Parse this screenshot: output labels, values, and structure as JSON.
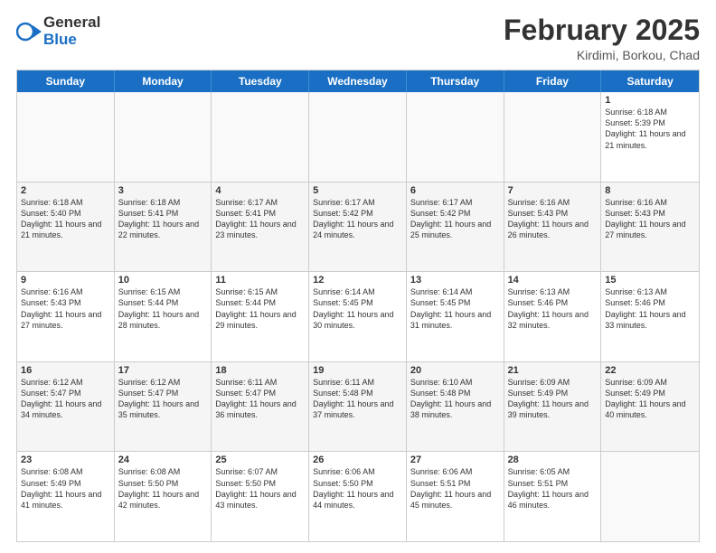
{
  "logo": {
    "general": "General",
    "blue": "Blue"
  },
  "title": "February 2025",
  "location": "Kirdimi, Borkou, Chad",
  "header_days": [
    "Sunday",
    "Monday",
    "Tuesday",
    "Wednesday",
    "Thursday",
    "Friday",
    "Saturday"
  ],
  "weeks": [
    [
      {
        "day": "",
        "text": ""
      },
      {
        "day": "",
        "text": ""
      },
      {
        "day": "",
        "text": ""
      },
      {
        "day": "",
        "text": ""
      },
      {
        "day": "",
        "text": ""
      },
      {
        "day": "",
        "text": ""
      },
      {
        "day": "1",
        "text": "Sunrise: 6:18 AM\nSunset: 5:39 PM\nDaylight: 11 hours and 21 minutes."
      }
    ],
    [
      {
        "day": "2",
        "text": "Sunrise: 6:18 AM\nSunset: 5:40 PM\nDaylight: 11 hours and 21 minutes."
      },
      {
        "day": "3",
        "text": "Sunrise: 6:18 AM\nSunset: 5:41 PM\nDaylight: 11 hours and 22 minutes."
      },
      {
        "day": "4",
        "text": "Sunrise: 6:17 AM\nSunset: 5:41 PM\nDaylight: 11 hours and 23 minutes."
      },
      {
        "day": "5",
        "text": "Sunrise: 6:17 AM\nSunset: 5:42 PM\nDaylight: 11 hours and 24 minutes."
      },
      {
        "day": "6",
        "text": "Sunrise: 6:17 AM\nSunset: 5:42 PM\nDaylight: 11 hours and 25 minutes."
      },
      {
        "day": "7",
        "text": "Sunrise: 6:16 AM\nSunset: 5:43 PM\nDaylight: 11 hours and 26 minutes."
      },
      {
        "day": "8",
        "text": "Sunrise: 6:16 AM\nSunset: 5:43 PM\nDaylight: 11 hours and 27 minutes."
      }
    ],
    [
      {
        "day": "9",
        "text": "Sunrise: 6:16 AM\nSunset: 5:43 PM\nDaylight: 11 hours and 27 minutes."
      },
      {
        "day": "10",
        "text": "Sunrise: 6:15 AM\nSunset: 5:44 PM\nDaylight: 11 hours and 28 minutes."
      },
      {
        "day": "11",
        "text": "Sunrise: 6:15 AM\nSunset: 5:44 PM\nDaylight: 11 hours and 29 minutes."
      },
      {
        "day": "12",
        "text": "Sunrise: 6:14 AM\nSunset: 5:45 PM\nDaylight: 11 hours and 30 minutes."
      },
      {
        "day": "13",
        "text": "Sunrise: 6:14 AM\nSunset: 5:45 PM\nDaylight: 11 hours and 31 minutes."
      },
      {
        "day": "14",
        "text": "Sunrise: 6:13 AM\nSunset: 5:46 PM\nDaylight: 11 hours and 32 minutes."
      },
      {
        "day": "15",
        "text": "Sunrise: 6:13 AM\nSunset: 5:46 PM\nDaylight: 11 hours and 33 minutes."
      }
    ],
    [
      {
        "day": "16",
        "text": "Sunrise: 6:12 AM\nSunset: 5:47 PM\nDaylight: 11 hours and 34 minutes."
      },
      {
        "day": "17",
        "text": "Sunrise: 6:12 AM\nSunset: 5:47 PM\nDaylight: 11 hours and 35 minutes."
      },
      {
        "day": "18",
        "text": "Sunrise: 6:11 AM\nSunset: 5:47 PM\nDaylight: 11 hours and 36 minutes."
      },
      {
        "day": "19",
        "text": "Sunrise: 6:11 AM\nSunset: 5:48 PM\nDaylight: 11 hours and 37 minutes."
      },
      {
        "day": "20",
        "text": "Sunrise: 6:10 AM\nSunset: 5:48 PM\nDaylight: 11 hours and 38 minutes."
      },
      {
        "day": "21",
        "text": "Sunrise: 6:09 AM\nSunset: 5:49 PM\nDaylight: 11 hours and 39 minutes."
      },
      {
        "day": "22",
        "text": "Sunrise: 6:09 AM\nSunset: 5:49 PM\nDaylight: 11 hours and 40 minutes."
      }
    ],
    [
      {
        "day": "23",
        "text": "Sunrise: 6:08 AM\nSunset: 5:49 PM\nDaylight: 11 hours and 41 minutes."
      },
      {
        "day": "24",
        "text": "Sunrise: 6:08 AM\nSunset: 5:50 PM\nDaylight: 11 hours and 42 minutes."
      },
      {
        "day": "25",
        "text": "Sunrise: 6:07 AM\nSunset: 5:50 PM\nDaylight: 11 hours and 43 minutes."
      },
      {
        "day": "26",
        "text": "Sunrise: 6:06 AM\nSunset: 5:50 PM\nDaylight: 11 hours and 44 minutes."
      },
      {
        "day": "27",
        "text": "Sunrise: 6:06 AM\nSunset: 5:51 PM\nDaylight: 11 hours and 45 minutes."
      },
      {
        "day": "28",
        "text": "Sunrise: 6:05 AM\nSunset: 5:51 PM\nDaylight: 11 hours and 46 minutes."
      },
      {
        "day": "",
        "text": ""
      }
    ]
  ]
}
